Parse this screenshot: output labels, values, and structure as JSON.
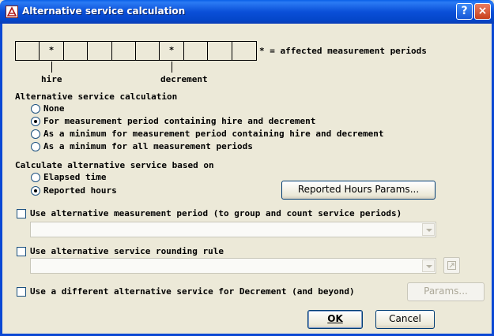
{
  "window": {
    "title": "Alternative service calculation",
    "help_glyph": "?",
    "close_glyph": "×"
  },
  "periods": {
    "cells": [
      "",
      "*",
      "",
      "",
      "",
      "",
      "*",
      "",
      "",
      ""
    ],
    "legend": "* = affected measurement periods",
    "hire_label": "hire",
    "decrement_label": "decrement"
  },
  "alt_calc": {
    "heading": "Alternative service calculation",
    "options": [
      {
        "label": "None",
        "checked": false
      },
      {
        "label": "For measurement period containing hire and decrement",
        "checked": true
      },
      {
        "label": "As a minimum for measurement period containing hire and decrement",
        "checked": false
      },
      {
        "label": "As a minimum for all measurement periods",
        "checked": false
      }
    ]
  },
  "basis": {
    "heading": "Calculate alternative service based on",
    "options": [
      {
        "label": "Elapsed time",
        "checked": false
      },
      {
        "label": "Reported hours",
        "checked": true
      }
    ],
    "params_button": "Reported Hours Params..."
  },
  "alt_period": {
    "label": "Use alternative measurement period (to group and count service periods)",
    "checked": false,
    "value": ""
  },
  "rounding": {
    "label": "Use alternative service rounding rule",
    "checked": false,
    "value": ""
  },
  "decrement": {
    "label": "Use a different alternative service for Decrement (and beyond)",
    "checked": false,
    "params_button": "Params..."
  },
  "footer": {
    "ok_label": "OK",
    "cancel_label": "Cancel"
  },
  "icons": {
    "app": "app-icon",
    "help": "help-icon",
    "close": "close-icon",
    "dropdown": "chevron-down-icon",
    "lookup": "lookup-icon"
  }
}
